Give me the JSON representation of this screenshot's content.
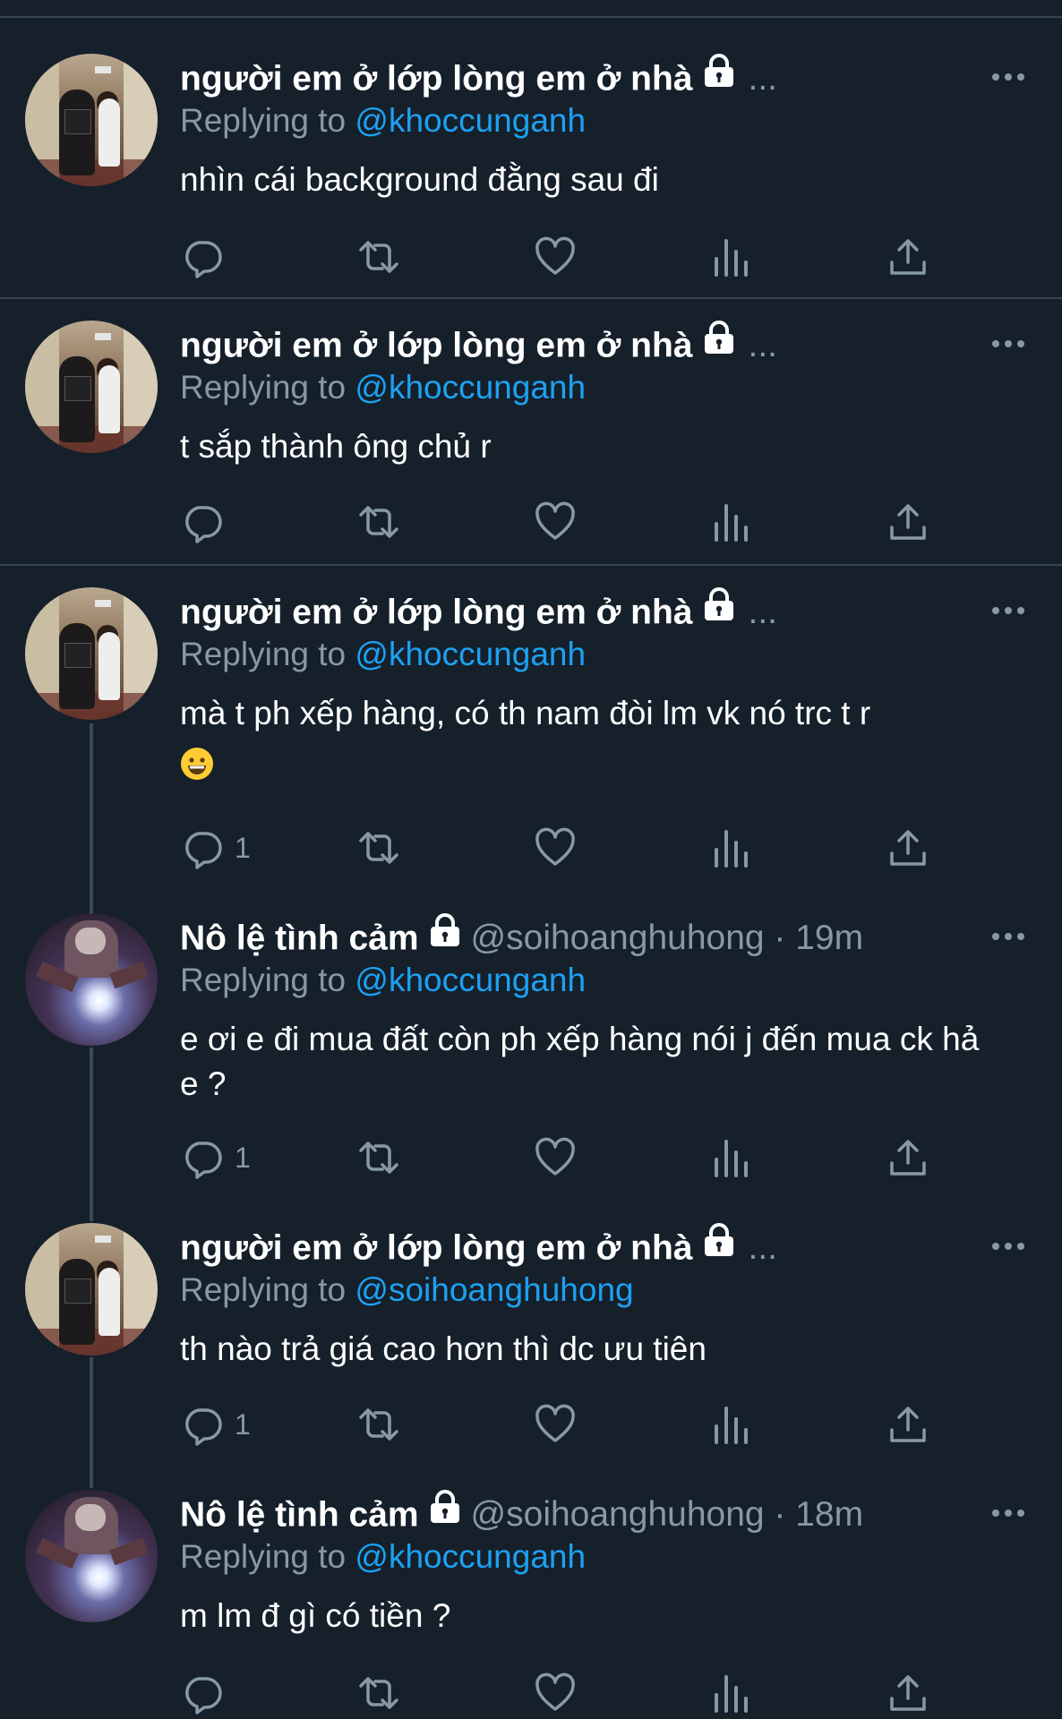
{
  "colors": {
    "background": "#15202b",
    "divider": "#38444d",
    "secondary_text": "#8899a6",
    "mention": "#1da1f2",
    "icon": "#8899a6"
  },
  "icons": {
    "more": "more-horizontal-icon",
    "lock": "lock-icon",
    "reply": "reply-bubble-icon",
    "retweet": "retweet-icon",
    "like": "heart-icon",
    "views": "analytics-bars-icon",
    "share": "share-upload-icon"
  },
  "tweets": [
    {
      "display_name": "người em ở lớp lòng em ở nhà",
      "handle_time": "",
      "truncated": "...",
      "reply_prefix": "Replying to",
      "mention": "@khoccunganh",
      "text": "nhìn cái background đằng sau đi",
      "reply_count": "",
      "avatar": "hallway"
    },
    {
      "display_name": "người em ở lớp lòng em ở nhà",
      "handle_time": "",
      "truncated": "...",
      "reply_prefix": "Replying to",
      "mention": "@khoccunganh",
      "text": "t sắp thành ông chủ r",
      "reply_count": "",
      "avatar": "hallway"
    },
    {
      "display_name": "người em ở lớp lòng em ở nhà",
      "handle_time": "",
      "truncated": "...",
      "reply_prefix": "Replying to",
      "mention": "@khoccunganh",
      "text": "mà t ph xếp hàng, có th nam đòi lm vk nó trc t r",
      "emoji": "grinning-face-emoji",
      "reply_count": "1",
      "avatar": "hallway"
    },
    {
      "display_name": "Nô lệ tình cảm",
      "handle_time": "@soihoanghuhong · 19m",
      "truncated": "",
      "reply_prefix": "Replying to",
      "mention": "@khoccunganh",
      "text": "e ơi e đi mua đất còn ph xếp hàng nói j đến mua ck hả e ?",
      "reply_count": "1",
      "avatar": "moto"
    },
    {
      "display_name": "người em ở lớp lòng em ở nhà",
      "handle_time": "",
      "truncated": "...",
      "reply_prefix": "Replying to",
      "mention": "@soihoanghuhong",
      "text": "th nào trả giá cao hơn thì dc ưu tiên",
      "reply_count": "1",
      "avatar": "hallway"
    },
    {
      "display_name": "Nô lệ tình cảm",
      "handle_time": "@soihoanghuhong · 18m",
      "truncated": "",
      "reply_prefix": "Replying to",
      "mention": "@khoccunganh",
      "text": "m lm đ gì có tiền ?",
      "reply_count": "",
      "avatar": "moto"
    }
  ]
}
